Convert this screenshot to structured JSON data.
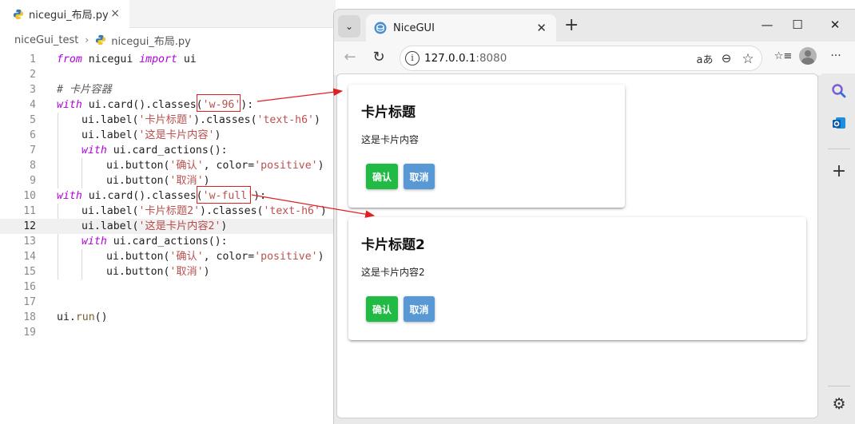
{
  "editor": {
    "tab_label": "nicegui_布局.py",
    "tab_close": "×",
    "breadcrumb": {
      "folder": "niceGui_test",
      "sep": "›",
      "file": "nicegui_布局.py"
    },
    "lines": [
      {
        "n": "1"
      },
      {
        "n": "2"
      },
      {
        "n": "3"
      },
      {
        "n": "4"
      },
      {
        "n": "5"
      },
      {
        "n": "6"
      },
      {
        "n": "7"
      },
      {
        "n": "8"
      },
      {
        "n": "9"
      },
      {
        "n": "10"
      },
      {
        "n": "11"
      },
      {
        "n": "12"
      },
      {
        "n": "13"
      },
      {
        "n": "14"
      },
      {
        "n": "15"
      },
      {
        "n": "16"
      },
      {
        "n": "17"
      },
      {
        "n": "18"
      },
      {
        "n": "19"
      }
    ],
    "tok": {
      "from": "from",
      "nicegui": " nicegui ",
      "import": "import",
      "ui": " ui",
      "comment": "# 卡片容器",
      "with": "with",
      "ui_card": " ui.card().classes(",
      "close_colon": "):",
      "w96": "'w-96'",
      "wfull": "'w-full'",
      "ui_label": "ui.label(",
      "classes": ").classes(",
      "close": ")",
      "title1": "'卡片标题'",
      "title2": "'卡片标题2'",
      "h6": "'text-h6'",
      "content1": "'这是卡片内容'",
      "content2": "'这是卡片内容2'",
      "card_actions": " ui.card_actions():",
      "ui_button": "ui.button(",
      "confirm": "'确认'",
      "comma_color": ", color=",
      "positive": "'positive'",
      "cancel": "'取消'",
      "ui_run_ui": "ui.",
      "run": "run",
      "run_paren": "()"
    },
    "active_line": "12"
  },
  "browser": {
    "tab_title": "NiceGUI",
    "tab_close": "✕",
    "new_tab": "+",
    "tab_search": "⌄",
    "win_min": "—",
    "win_max": "☐",
    "win_close": "✕",
    "nav": {
      "back": "←",
      "reload": "↻"
    },
    "address": {
      "info": "i",
      "host": "127.0.0.1",
      "port": ":8080"
    },
    "toolbar_icons": {
      "read_aloud": "aあ",
      "zoom": "⊖",
      "favorite": "☆",
      "favorites": "☆≡",
      "menu": "···"
    },
    "sidebar": {
      "add": "+",
      "settings": "⚙"
    }
  },
  "page": {
    "cards": [
      {
        "title": "卡片标题",
        "content": "这是卡片内容",
        "confirm": "确认",
        "cancel": "取消"
      },
      {
        "title": "卡片标题2",
        "content": "这是卡片内容2",
        "confirm": "确认",
        "cancel": "取消"
      }
    ]
  },
  "colors": {
    "positive": "#21ba45",
    "primary": "#5898d4",
    "annotation": "#e02020"
  }
}
